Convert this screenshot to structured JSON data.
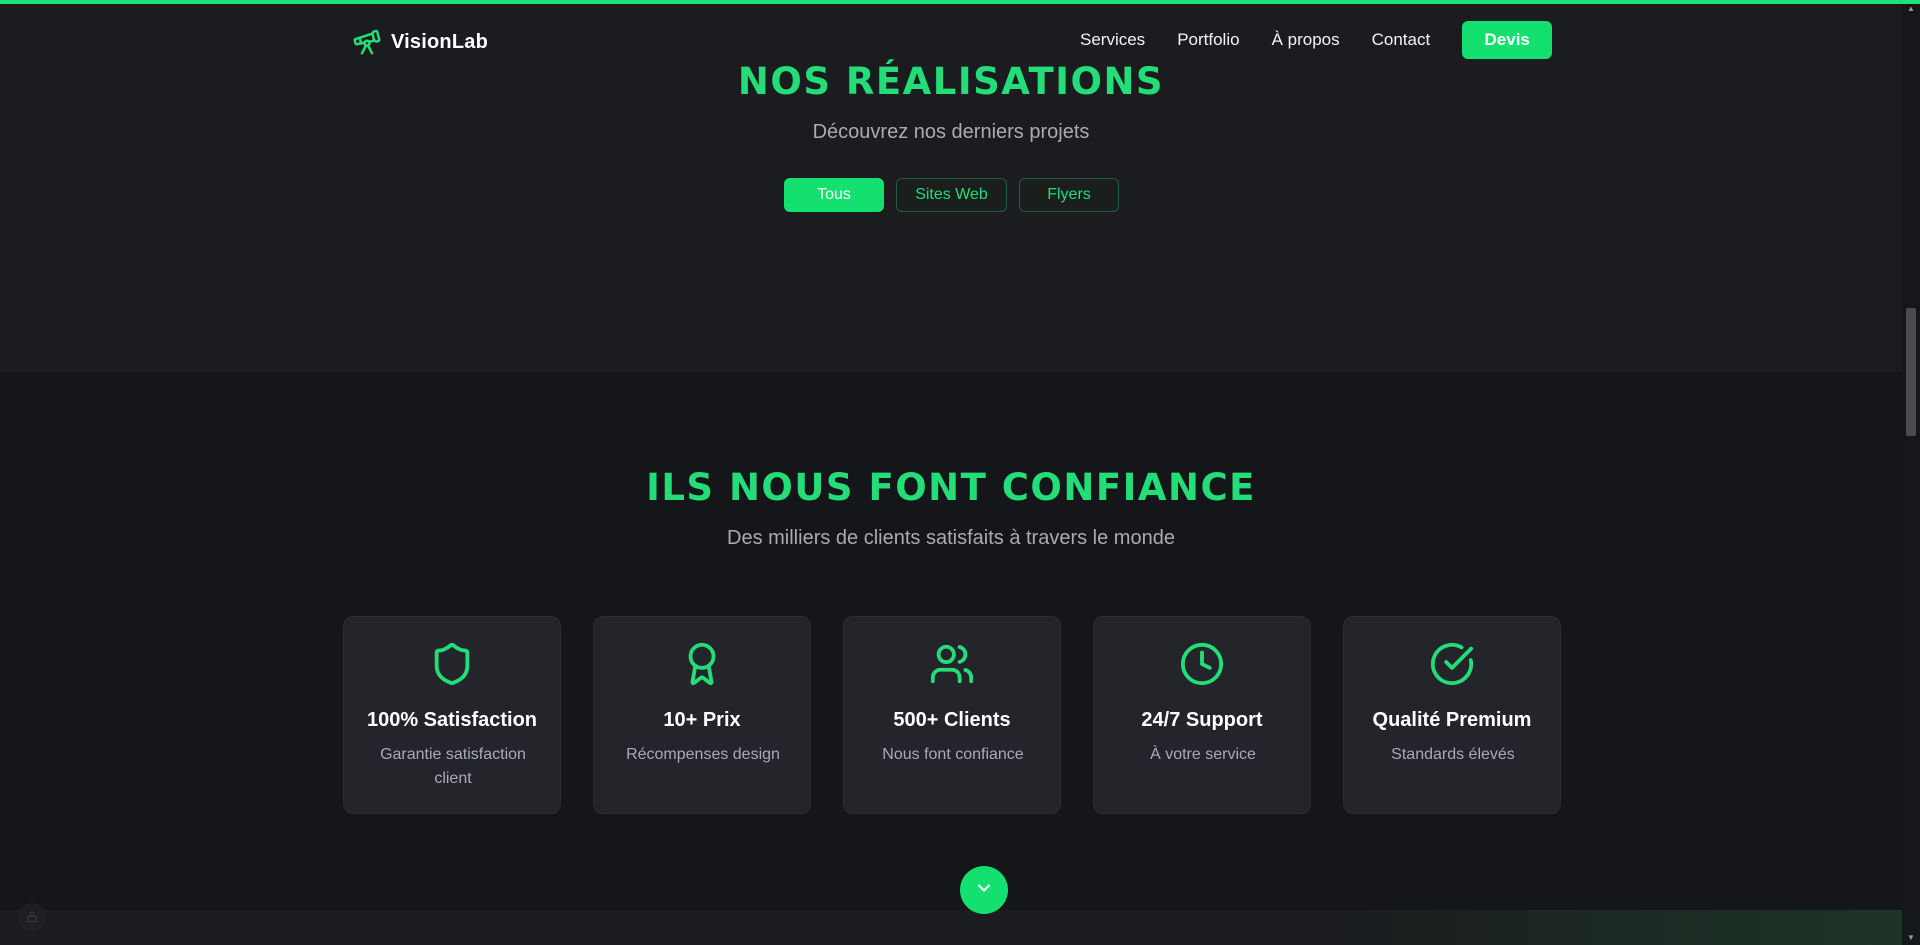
{
  "header": {
    "brand": "VisionLab",
    "nav": [
      "Services",
      "Portfolio",
      "À propos",
      "Contact"
    ],
    "cta": "Devis"
  },
  "realisations": {
    "title": "NOS RÉALISATIONS",
    "subtitle": "Découvrez nos derniers projets",
    "filters": [
      "Tous",
      "Sites Web",
      "Flyers"
    ],
    "active_filter": "Tous"
  },
  "trust": {
    "title": "ILS NOUS FONT CONFIANCE",
    "subtitle": "Des milliers de clients satisfaits à travers le monde",
    "cards": [
      {
        "icon": "shield-icon",
        "title": "100% Satisfaction",
        "desc": "Garantie satisfaction client"
      },
      {
        "icon": "award-icon",
        "title": "10+ Prix",
        "desc": "Récompenses design"
      },
      {
        "icon": "users-icon",
        "title": "500+ Clients",
        "desc": "Nous font confiance"
      },
      {
        "icon": "clock-icon",
        "title": "24/7 Support",
        "desc": "À votre service"
      },
      {
        "icon": "check-circle-icon",
        "title": "Qualité Premium",
        "desc": "Standards élevés"
      }
    ]
  },
  "colors": {
    "accent": "#14e06f",
    "title_green": "#23dd78",
    "background": "#1b1c20",
    "section_bg": "#151619",
    "card_bg": "#24252b"
  }
}
